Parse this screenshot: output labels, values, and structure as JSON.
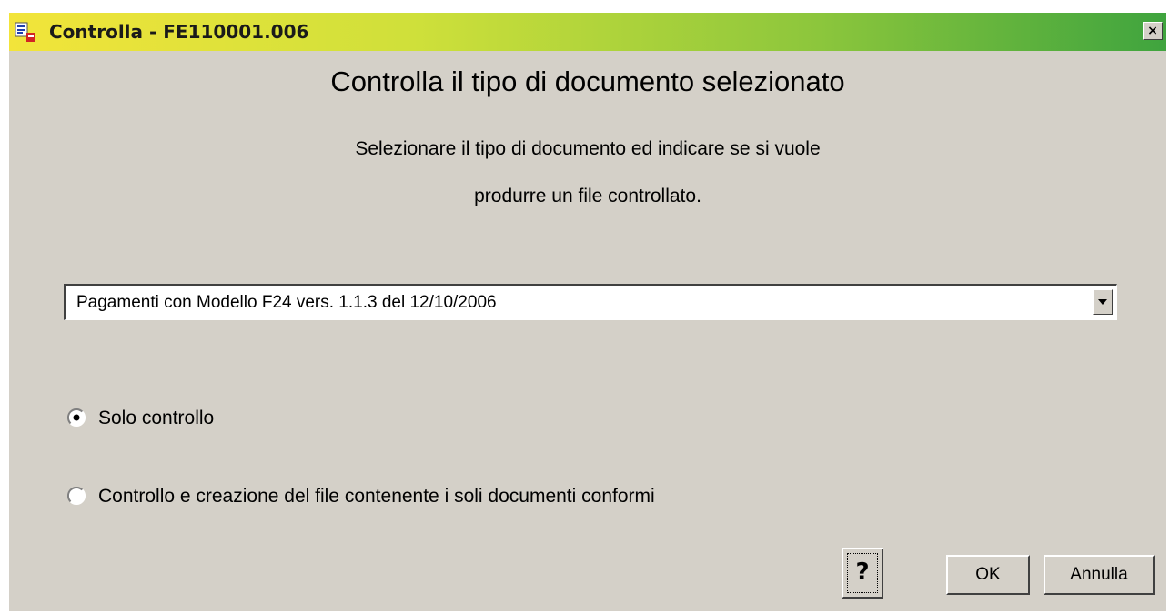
{
  "window": {
    "title": "Controlla - FE110001.006",
    "close_label": "×",
    "app_icon": "application-icon",
    "title_gradient": [
      "#f2e43a",
      "#8cc63c",
      "#3fa43e"
    ]
  },
  "content": {
    "heading": "Controlla il tipo di documento selezionato",
    "instruction_line1": "Selezionare il tipo di documento ed indicare se si vuole",
    "instruction_line2": "produrre un file controllato."
  },
  "document_type_select": {
    "selected_value": "Pagamenti con Modello F24  vers. 1.1.3 del 12/10/2006"
  },
  "mode_options": [
    {
      "label": "Solo controllo",
      "selected": true
    },
    {
      "label": "Controllo e creazione del file contenente i soli documenti conformi",
      "selected": false
    }
  ],
  "buttons": {
    "help_label": "?",
    "ok_label": "OK",
    "cancel_label": "Annulla"
  }
}
